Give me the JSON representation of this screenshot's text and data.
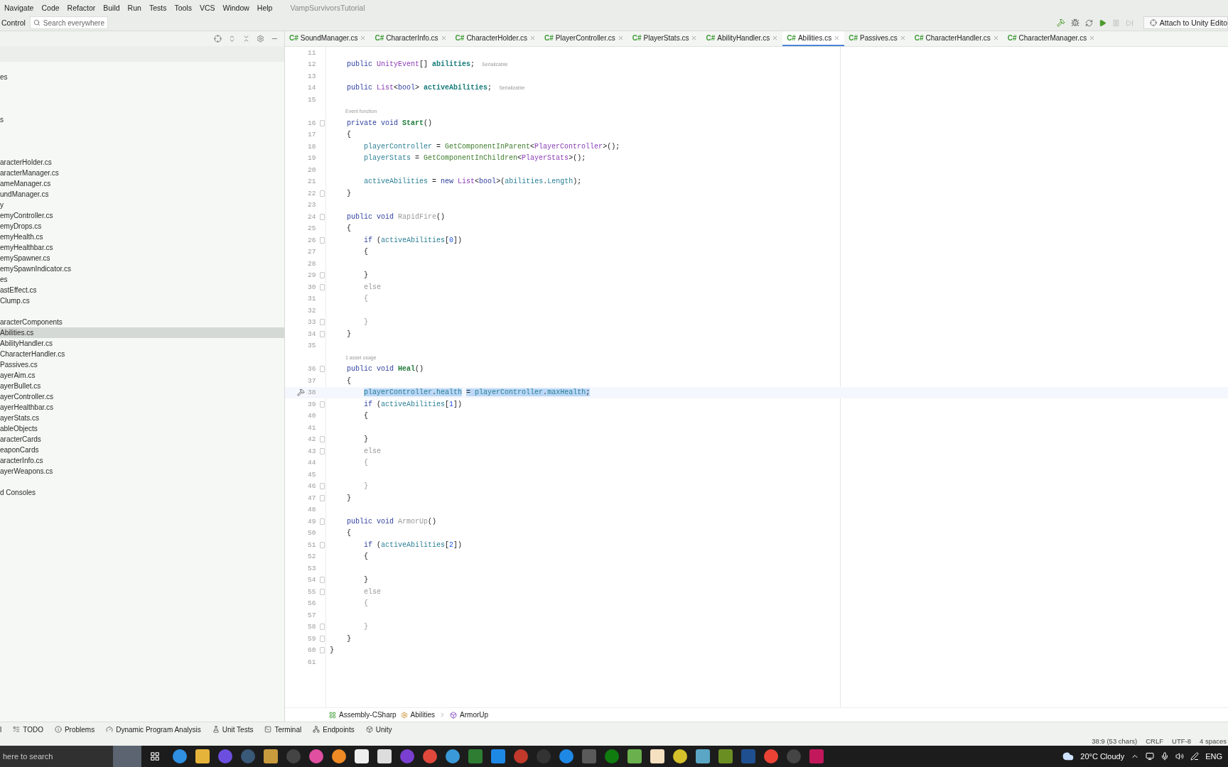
{
  "menu": {
    "items": [
      "Navigate",
      "Code",
      "Refactor",
      "Build",
      "Run",
      "Tests",
      "Tools",
      "VCS",
      "Window",
      "Help"
    ],
    "project": "VampSurvivorsTutorial"
  },
  "toolbar": {
    "label": "Control",
    "search": {
      "placeholder": "Search everywhere"
    },
    "attach": "Attach to Unity Edito"
  },
  "sidebar": {
    "items": [
      {
        "text": "es",
        "selected": false
      },
      {
        "text": "s",
        "selected": false
      },
      {
        "text": "aracterHolder.cs",
        "selected": false
      },
      {
        "text": "aracterManager.cs",
        "selected": false
      },
      {
        "text": "ameManager.cs",
        "selected": false
      },
      {
        "text": "undManager.cs",
        "selected": false
      },
      {
        "text": "y",
        "selected": false
      },
      {
        "text": "emyController.cs",
        "selected": false
      },
      {
        "text": "emyDrops.cs",
        "selected": false
      },
      {
        "text": "emyHealth.cs",
        "selected": false
      },
      {
        "text": "emyHealthbar.cs",
        "selected": false
      },
      {
        "text": "emySpawner.cs",
        "selected": false
      },
      {
        "text": "emySpawnIndicator.cs",
        "selected": false
      },
      {
        "text": "es",
        "selected": false
      },
      {
        "text": "astEffect.cs",
        "selected": false
      },
      {
        "text": "Clump.cs",
        "selected": false
      },
      {
        "text": "aracterComponents",
        "selected": false
      },
      {
        "text": "Abilities.cs",
        "selected": true
      },
      {
        "text": "AbilityHandler.cs",
        "selected": false
      },
      {
        "text": "CharacterHandler.cs",
        "selected": false
      },
      {
        "text": "Passives.cs",
        "selected": false
      },
      {
        "text": "ayerAim.cs",
        "selected": false
      },
      {
        "text": "ayerBullet.cs",
        "selected": false
      },
      {
        "text": "ayerController.cs",
        "selected": false
      },
      {
        "text": "ayerHealthbar.cs",
        "selected": false
      },
      {
        "text": "ayerStats.cs",
        "selected": false
      },
      {
        "text": "ableObjects",
        "selected": false
      },
      {
        "text": "aracterCards",
        "selected": false
      },
      {
        "text": "eaponCards",
        "selected": false
      },
      {
        "text": "aracterInfo.cs",
        "selected": false
      },
      {
        "text": "ayerWeapons.cs",
        "selected": false
      },
      {
        "text": "d Consoles",
        "selected": false
      }
    ]
  },
  "tabs": [
    {
      "badge": "C#",
      "label": "SoundManager.cs",
      "selected": false
    },
    {
      "badge": "C#",
      "label": "CharacterInfo.cs",
      "selected": false
    },
    {
      "badge": "C#",
      "label": "CharacterHolder.cs",
      "selected": false
    },
    {
      "badge": "C#",
      "label": "PlayerController.cs",
      "selected": false
    },
    {
      "badge": "C#",
      "label": "PlayerStats.cs",
      "selected": false
    },
    {
      "badge": "C#",
      "label": "AbilityHandler.cs",
      "selected": false
    },
    {
      "badge": "C#",
      "label": "Abilities.cs",
      "selected": true
    },
    {
      "badge": "C#",
      "label": "Passives.cs",
      "selected": false
    },
    {
      "badge": "C#",
      "label": "CharacterHandler.cs",
      "selected": false
    },
    {
      "badge": "C#",
      "label": "CharacterManager.cs",
      "selected": false
    }
  ],
  "editor": {
    "lines": [
      {
        "kind": "code",
        "number": "11"
      },
      {
        "kind": "code",
        "number": "12",
        "hint": "Serializable",
        "tokens": [
          {
            "text": "    public ",
            "kind": "kw"
          },
          {
            "text": "UnityEvent",
            "kind": "type"
          },
          {
            "text": "[] ",
            "kind": "plain"
          },
          {
            "text": "abilities",
            "kind": "field_decl"
          },
          {
            "text": ";",
            "kind": "plain"
          }
        ]
      },
      {
        "kind": "code",
        "number": "13"
      },
      {
        "kind": "code",
        "number": "14",
        "hint": "Serializable",
        "tokens": [
          {
            "text": "    public ",
            "kind": "kw"
          },
          {
            "text": "List",
            "kind": "type"
          },
          {
            "text": "<",
            "kind": "plain"
          },
          {
            "text": "bool",
            "kind": "kw"
          },
          {
            "text": "> ",
            "kind": "plain"
          },
          {
            "text": "activeAbilities",
            "kind": "field_decl"
          },
          {
            "text": ";",
            "kind": "plain"
          }
        ]
      },
      {
        "kind": "code",
        "number": "15"
      },
      {
        "kind": "hint",
        "text": "Event function"
      },
      {
        "kind": "code",
        "number": "16",
        "fold": true,
        "tokens": [
          {
            "text": "    private void ",
            "kind": "kw"
          },
          {
            "text": "Start",
            "kind": "method_decl"
          },
          {
            "text": "()",
            "kind": "plain"
          }
        ]
      },
      {
        "kind": "code",
        "number": "17",
        "tokens": [
          {
            "text": "    {",
            "kind": "plain"
          }
        ]
      },
      {
        "kind": "code",
        "number": "18",
        "tokens": [
          {
            "text": "        playerController",
            "kind": "field"
          },
          {
            "text": " = ",
            "kind": "plain"
          },
          {
            "text": "GetComponentInParent",
            "kind": "method"
          },
          {
            "text": "<",
            "kind": "plain"
          },
          {
            "text": "PlayerController",
            "kind": "type"
          },
          {
            "text": ">();",
            "kind": "plain"
          }
        ]
      },
      {
        "kind": "code",
        "number": "19",
        "tokens": [
          {
            "text": "        playerStats",
            "kind": "field"
          },
          {
            "text": " = ",
            "kind": "plain"
          },
          {
            "text": "GetComponentInChildren",
            "kind": "method"
          },
          {
            "text": "<",
            "kind": "plain"
          },
          {
            "text": "PlayerStats",
            "kind": "type"
          },
          {
            "text": ">();",
            "kind": "plain"
          }
        ]
      },
      {
        "kind": "code",
        "number": "20"
      },
      {
        "kind": "code",
        "number": "21",
        "tokens": [
          {
            "text": "        activeAbilities",
            "kind": "field"
          },
          {
            "text": " = ",
            "kind": "plain"
          },
          {
            "text": "new ",
            "kind": "kw"
          },
          {
            "text": "List",
            "kind": "type"
          },
          {
            "text": "<",
            "kind": "plain"
          },
          {
            "text": "bool",
            "kind": "kw"
          },
          {
            "text": ">(",
            "kind": "plain"
          },
          {
            "text": "abilities",
            "kind": "field"
          },
          {
            "text": ".",
            "kind": "plain"
          },
          {
            "text": "Length",
            "kind": "field"
          },
          {
            "text": ");",
            "kind": "plain"
          }
        ]
      },
      {
        "kind": "code",
        "number": "22",
        "fold": true,
        "tokens": [
          {
            "text": "    }",
            "kind": "plain"
          }
        ]
      },
      {
        "kind": "code",
        "number": "23"
      },
      {
        "kind": "code",
        "number": "24",
        "fold": true,
        "tokens": [
          {
            "text": "    public void ",
            "kind": "kw"
          },
          {
            "text": "RapidFire",
            "kind": "dim"
          },
          {
            "text": "()",
            "kind": "plain"
          }
        ]
      },
      {
        "kind": "code",
        "number": "25",
        "tokens": [
          {
            "text": "    {",
            "kind": "plain"
          }
        ]
      },
      {
        "kind": "code",
        "number": "26",
        "fold": true,
        "tokens": [
          {
            "text": "        if ",
            "kind": "kw"
          },
          {
            "text": "(",
            "kind": "plain"
          },
          {
            "text": "activeAbilities",
            "kind": "field"
          },
          {
            "text": "[",
            "kind": "plain"
          },
          {
            "text": "0",
            "kind": "num"
          },
          {
            "text": "])",
            "kind": "plain"
          }
        ]
      },
      {
        "kind": "code",
        "number": "27",
        "tokens": [
          {
            "text": "        {",
            "kind": "plain"
          }
        ]
      },
      {
        "kind": "code",
        "number": "28"
      },
      {
        "kind": "code",
        "number": "29",
        "fold": true,
        "tokens": [
          {
            "text": "        }",
            "kind": "plain"
          }
        ]
      },
      {
        "kind": "code",
        "number": "30",
        "fold": true,
        "tokens": [
          {
            "text": "        else",
            "kind": "dim"
          }
        ]
      },
      {
        "kind": "code",
        "number": "31",
        "tokens": [
          {
            "text": "        {",
            "kind": "dim"
          }
        ]
      },
      {
        "kind": "code",
        "number": "32"
      },
      {
        "kind": "code",
        "number": "33",
        "fold": true,
        "tokens": [
          {
            "text": "        }",
            "kind": "dim"
          }
        ]
      },
      {
        "kind": "code",
        "number": "34",
        "fold": true,
        "tokens": [
          {
            "text": "    }",
            "kind": "plain"
          }
        ]
      },
      {
        "kind": "code",
        "number": "35"
      },
      {
        "kind": "hint",
        "text": "1 asset usage"
      },
      {
        "kind": "code",
        "number": "36",
        "fold": true,
        "tokens": [
          {
            "text": "    public void ",
            "kind": "kw"
          },
          {
            "text": "Heal",
            "kind": "method_decl"
          },
          {
            "text": "()",
            "kind": "plain"
          }
        ]
      },
      {
        "kind": "code",
        "number": "37",
        "tokens": [
          {
            "text": "    {",
            "kind": "plain"
          }
        ]
      },
      {
        "kind": "code",
        "number": "38",
        "caret": true,
        "tokens": [
          {
            "text": "        playerController",
            "kind": "field",
            "selected": true
          },
          {
            "text": ".",
            "kind": "plain",
            "selected": true
          },
          {
            "text": "health",
            "kind": "field",
            "selected": true
          },
          {
            "text": " = ",
            "kind": "plain",
            "selected": true
          },
          {
            "text": "playerController",
            "kind": "field",
            "selected": true
          },
          {
            "text": ".",
            "kind": "plain",
            "selected": true
          },
          {
            "text": "maxHealth",
            "kind": "field",
            "selected": true
          },
          {
            "text": ";",
            "kind": "plain",
            "selected": true
          }
        ]
      },
      {
        "kind": "code",
        "number": "39",
        "fold": true,
        "tokens": [
          {
            "text": "        if ",
            "kind": "kw"
          },
          {
            "text": "(",
            "kind": "plain"
          },
          {
            "text": "activeAbilities",
            "kind": "field"
          },
          {
            "text": "[",
            "kind": "plain"
          },
          {
            "text": "1",
            "kind": "num"
          },
          {
            "text": "])",
            "kind": "plain"
          }
        ]
      },
      {
        "kind": "code",
        "number": "40",
        "tokens": [
          {
            "text": "        {",
            "kind": "plain"
          }
        ]
      },
      {
        "kind": "code",
        "number": "41"
      },
      {
        "kind": "code",
        "number": "42",
        "fold": true,
        "tokens": [
          {
            "text": "        }",
            "kind": "plain"
          }
        ]
      },
      {
        "kind": "code",
        "number": "43",
        "fold": true,
        "tokens": [
          {
            "text": "        else",
            "kind": "dim"
          }
        ]
      },
      {
        "kind": "code",
        "number": "44",
        "tokens": [
          {
            "text": "        {",
            "kind": "dim"
          }
        ]
      },
      {
        "kind": "code",
        "number": "45"
      },
      {
        "kind": "code",
        "number": "46",
        "fold": true,
        "tokens": [
          {
            "text": "        }",
            "kind": "dim"
          }
        ]
      },
      {
        "kind": "code",
        "number": "47",
        "fold": true,
        "tokens": [
          {
            "text": "    }",
            "kind": "plain"
          }
        ]
      },
      {
        "kind": "code",
        "number": "48"
      },
      {
        "kind": "code",
        "number": "49",
        "fold": true,
        "tokens": [
          {
            "text": "    public void ",
            "kind": "kw"
          },
          {
            "text": "ArmorUp",
            "kind": "dim"
          },
          {
            "text": "()",
            "kind": "plain"
          }
        ]
      },
      {
        "kind": "code",
        "number": "50",
        "tokens": [
          {
            "text": "    {",
            "kind": "plain"
          }
        ]
      },
      {
        "kind": "code",
        "number": "51",
        "fold": true,
        "tokens": [
          {
            "text": "        if ",
            "kind": "kw"
          },
          {
            "text": "(",
            "kind": "plain"
          },
          {
            "text": "activeAbilities",
            "kind": "field"
          },
          {
            "text": "[",
            "kind": "plain"
          },
          {
            "text": "2",
            "kind": "num"
          },
          {
            "text": "])",
            "kind": "plain"
          }
        ]
      },
      {
        "kind": "code",
        "number": "52",
        "tokens": [
          {
            "text": "        {",
            "kind": "plain"
          }
        ]
      },
      {
        "kind": "code",
        "number": "53"
      },
      {
        "kind": "code",
        "number": "54",
        "fold": true,
        "tokens": [
          {
            "text": "        }",
            "kind": "plain"
          }
        ]
      },
      {
        "kind": "code",
        "number": "55",
        "fold": true,
        "tokens": [
          {
            "text": "        else",
            "kind": "dim"
          }
        ]
      },
      {
        "kind": "code",
        "number": "56",
        "tokens": [
          {
            "text": "        {",
            "kind": "dim"
          }
        ]
      },
      {
        "kind": "code",
        "number": "57"
      },
      {
        "kind": "code",
        "number": "58",
        "fold": true,
        "tokens": [
          {
            "text": "        }",
            "kind": "dim"
          }
        ]
      },
      {
        "kind": "code",
        "number": "59",
        "fold": true,
        "tokens": [
          {
            "text": "    }",
            "kind": "plain"
          }
        ]
      },
      {
        "kind": "code",
        "number": "60",
        "fold": true,
        "tokens": [
          {
            "text": "}",
            "kind": "plain"
          }
        ]
      },
      {
        "kind": "code",
        "number": "61"
      }
    ],
    "breadcrumb": [
      "Assembly-CSharp",
      "Abilities",
      "ArmorUp"
    ]
  },
  "tool_windows": [
    "l",
    "TODO",
    "Problems",
    "Dynamic Program Analysis",
    "Unit Tests",
    "Terminal",
    "Endpoints",
    "Unity"
  ],
  "status_bar": [
    "38:9 (53 chars)",
    "CRLF",
    "UTF-8",
    "4 spaces"
  ],
  "taskbar": {
    "search": {
      "placeholder": "here to search"
    },
    "weather": "20°C Cloudy",
    "language": "ENG"
  }
}
